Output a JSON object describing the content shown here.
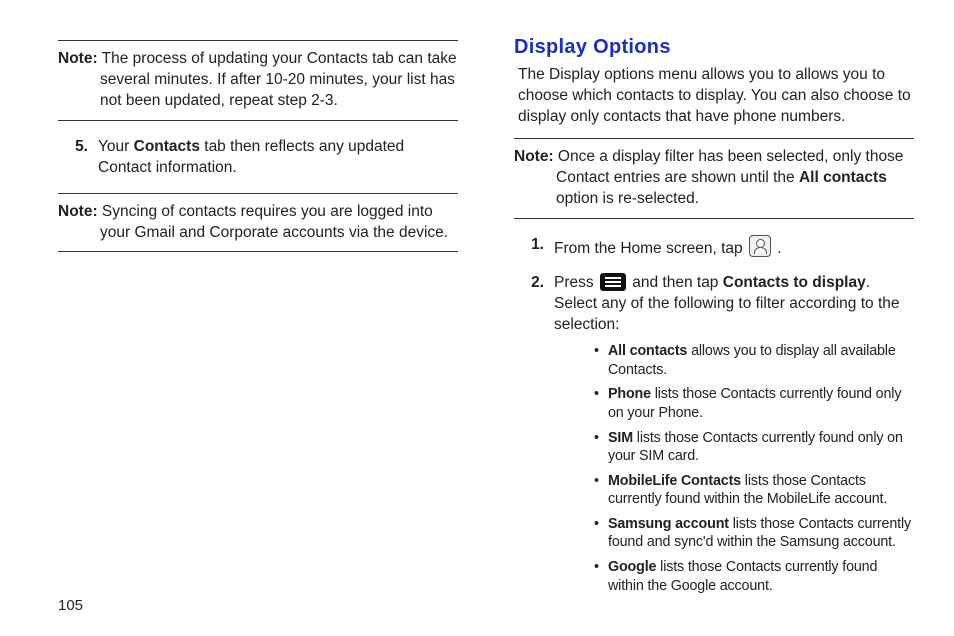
{
  "page_number": "105",
  "left": {
    "note1": {
      "label": "Note:",
      "text": "The process of updating your Contacts tab can take several minutes. If after 10-20 minutes, your list has not been updated, repeat step 2-3."
    },
    "step5": {
      "num": "5.",
      "pre": "Your ",
      "bold": "Contacts",
      "post": " tab then reflects any updated Contact information."
    },
    "note2": {
      "label": "Note:",
      "text": "Syncing of contacts requires you are logged into your Gmail and Corporate accounts via the device."
    }
  },
  "right": {
    "heading": "Display Options",
    "intro": "The Display options menu allows you to allows you to choose which contacts to display. You can also choose to display only contacts that have phone numbers.",
    "note": {
      "label": "Note:",
      "pre": "Once a display filter has been selected, only those Contact entries are shown until the ",
      "bold": "All contacts",
      "post": " option is re-selected."
    },
    "step1": {
      "num": "1.",
      "text_pre": "From the Home screen, tap ",
      "text_post": " ."
    },
    "step2": {
      "num": "2.",
      "text_pre": "Press ",
      "text_mid": " and then tap ",
      "bold": "Contacts to display",
      "text_post": ". Select any of the following to filter according to the selection:"
    },
    "bullets": [
      {
        "bold": "All contacts",
        "rest": " allows you to display all available Contacts."
      },
      {
        "bold": "Phone",
        "rest": " lists those Contacts currently found only on your Phone."
      },
      {
        "bold": "SIM",
        "rest": " lists those Contacts currently found only on your SIM card."
      },
      {
        "bold": "MobileLife Contacts",
        "rest": " lists those Contacts currently found within the MobileLife account."
      },
      {
        "bold": "Samsung account",
        "rest": " lists those Contacts currently found and sync'd within the Samsung account."
      },
      {
        "bold": "Google",
        "rest": " lists those Contacts currently found within the Google account."
      }
    ]
  }
}
